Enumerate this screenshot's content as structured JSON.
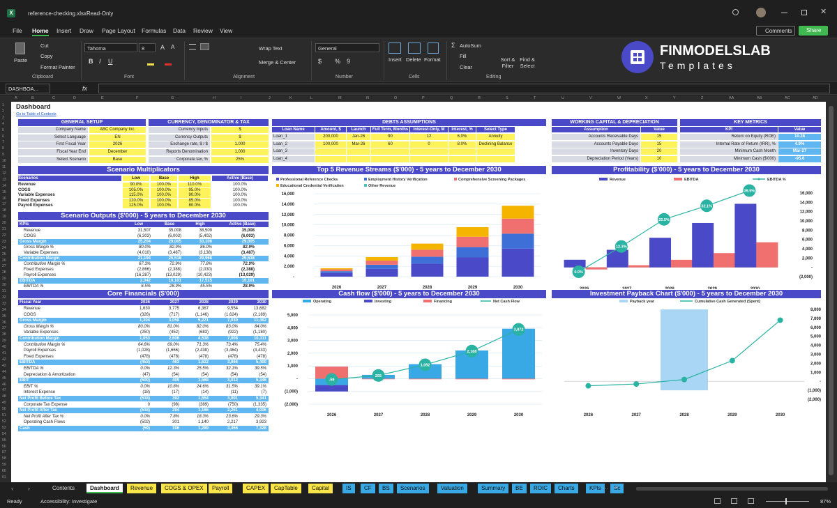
{
  "window": {
    "file": "reference-checking.xlsx",
    "mode": "Read-Only",
    "comments": "Comments",
    "share": "Share"
  },
  "menu": [
    "File",
    "Home",
    "Insert",
    "Draw",
    "Page Layout",
    "Formulas",
    "Data",
    "Review",
    "View"
  ],
  "ribbon": {
    "paste": "Paste",
    "cut": "Cut",
    "copy": "Copy",
    "format_painter": "Format Painter",
    "clipboard": "Clipboard",
    "font": "Tahoma",
    "size": "8",
    "font_label": "Font",
    "wrap": "Wrap Text",
    "merge": "Merge & Center",
    "alignment": "Alignment",
    "number_format": "General",
    "number": "Number",
    "insert": "Insert",
    "delete": "Delete",
    "format": "Format",
    "cells": "Cells",
    "autosum": "AutoSum",
    "fill": "Fill",
    "clear": "Clear",
    "sort": "Sort & Filter",
    "find": "Find & Select",
    "editing": "Editing",
    "brand1": "FINMODELSLAB",
    "brand2": "Templates"
  },
  "formula_bar": {
    "name_box": "DASHBOA...",
    "fx": "fx"
  },
  "columns": [
    "A",
    "B",
    "C",
    "D",
    "E",
    "F",
    "G",
    "H",
    "I",
    "J",
    "K",
    "L",
    "M",
    "N",
    "O",
    "P",
    "Q",
    "R",
    "S",
    "T",
    "U",
    "V",
    "W",
    "X",
    "Y",
    "Z",
    "AA",
    "AB",
    "AC",
    "AD"
  ],
  "sheet": {
    "title": "Dashboard",
    "link": "Go to Table of Contents",
    "general": {
      "header": "GENERAL SETUP",
      "rows": [
        [
          "Company Name",
          "ABC Company Inc."
        ],
        [
          "Select Language",
          "EN"
        ],
        [
          "First Fiscal Year",
          "2026"
        ],
        [
          "Fiscal Year End",
          "December"
        ],
        [
          "Select Scenario",
          "Base"
        ]
      ]
    },
    "currency": {
      "header": "CURRENCY, DENOMINATOR & TAX",
      "rows": [
        [
          "Currency Inputs",
          "$"
        ],
        [
          "Currency Outputs",
          "$"
        ],
        [
          "Exchange rate, $ / $",
          "1.000"
        ],
        [
          "Reports Denomination",
          "1,000"
        ],
        [
          "Corporate tax, %",
          "25%"
        ]
      ]
    },
    "debts": {
      "header": "DEBTS ASSUMPTIONS",
      "cols": [
        "Loan Name",
        "Amount, $",
        "Launch",
        "Full Term, Months",
        "Interest-Only, M",
        "Interest, %",
        "Select Type"
      ],
      "rows": [
        [
          "Loan_1",
          "200,000",
          "Jan-26",
          "90",
          "12",
          "6.0%",
          "Annuity"
        ],
        [
          "Loan_2",
          "100,000",
          "Mar-26",
          "60",
          "0",
          "8.0%",
          "Declining Balance"
        ],
        [
          "Loan_3",
          "",
          "",
          "",
          "",
          "",
          ""
        ],
        [
          "Loan_4",
          "",
          "",
          "",
          "",
          "",
          ""
        ]
      ]
    },
    "wc": {
      "header": "WORKING CAPITAL & DEPRECIATION",
      "cols": [
        "Assumption",
        "Value"
      ],
      "rows": [
        [
          "Accounts Receivable Days",
          "15"
        ],
        [
          "Accounts Payable Days",
          "15"
        ],
        [
          "Inventory Days",
          "20"
        ],
        [
          "Depreciation Period (Years)",
          "10"
        ]
      ]
    },
    "kpi": {
      "header": "KEY METRICS",
      "cols": [
        "KPI",
        "Value"
      ],
      "rows": [
        [
          "Return on Equity (ROE)",
          "10.28"
        ],
        [
          "Internal Rate of Return (IRR), %",
          "4.9%"
        ],
        [
          "Minimum Cash Month",
          "Mar-27"
        ],
        [
          "Minimum Cash ($'000)",
          "-95.6"
        ]
      ]
    },
    "multipliers": {
      "header": "Scenario Multiplicators",
      "cols": [
        "Scenarios",
        "Low",
        "Base",
        "High",
        "Active (Base)"
      ],
      "rows": [
        [
          "Revenue",
          "90.0%",
          "100.0%",
          "110.0%",
          "100.0%"
        ],
        [
          "COGS",
          "105.0%",
          "100.0%",
          "95.0%",
          "100.0%"
        ],
        [
          "Variable Expenses",
          "115.0%",
          "100.0%",
          "90.0%",
          "100.0%"
        ],
        [
          "Fixed Expenses",
          "120.0%",
          "100.0%",
          "85.0%",
          "100.0%"
        ],
        [
          "Payroll Expenses",
          "125.0%",
          "100.0%",
          "80.0%",
          "100.0%"
        ]
      ]
    },
    "outputs": {
      "header": "Scenario Outputs ($'000) - 5 years to December 2030",
      "cols": [
        "KPIs",
        "Low",
        "Base",
        "High",
        "Active (Base)"
      ],
      "rows": [
        [
          "Revenue",
          "31,507",
          "35,008",
          "38,509",
          "35,008",
          "n"
        ],
        [
          "COGS",
          "(6,303)",
          "(6,003)",
          "(5,402)",
          "(6,003)",
          "nb"
        ],
        [
          "Gross Margin",
          "25,204",
          "29,005",
          "33,106",
          "29,005",
          "h"
        ],
        [
          "Gross Margin %",
          "80.0%",
          "82.9%",
          "86.0%",
          "82.9%",
          "i"
        ],
        [
          "Variable Expenses",
          "(4,010)",
          "(3,487)",
          "(3,138)",
          "(3,487)",
          "nb"
        ],
        [
          "Contribution Margin",
          "21,194",
          "25,518",
          "29,968",
          "25,518",
          "h"
        ],
        [
          "Contribution Margin %",
          "67.3%",
          "72.9%",
          "77.8%",
          "72.9%",
          "i"
        ],
        [
          "Fixed Expenses",
          "(2,866)",
          "(2,388)",
          "(2,030)",
          "(2,388)",
          "nb"
        ],
        [
          "Payroll Expenses",
          "(16,287)",
          "(13,029)",
          "(10,423)",
          "(13,029)",
          "nb"
        ],
        [
          "EBITDA",
          "2,042",
          "10,101",
          "17,515",
          "10,101",
          "h"
        ],
        [
          "EBITDA %",
          "6.5%",
          "28.9%",
          "45.5%",
          "28.9%",
          "i"
        ]
      ]
    },
    "core": {
      "header": "Core Financials ($'000)",
      "cols": [
        "Fiscal Year",
        "2026",
        "2027",
        "2028",
        "2029",
        "2030"
      ],
      "rows": [
        [
          "Revenue",
          "1,630",
          "3,775",
          "6,367",
          "9,554",
          "13,682",
          "n"
        ],
        [
          "COGS",
          "(326)",
          "(717)",
          "(1,146)",
          "(1,624)",
          "(2,189)",
          "n"
        ],
        [
          "Gross Margin",
          "1,304",
          "3,058",
          "5,221",
          "7,930",
          "11,492",
          "h"
        ],
        [
          "Gross Margin %",
          "80.0%",
          "81.0%",
          "82.0%",
          "83.0%",
          "84.0%",
          "i"
        ],
        [
          "Variable Expenses",
          "(250)",
          "(452)",
          "(683)",
          "(922)",
          "(1,180)",
          "n"
        ],
        [
          "Contribution Margin",
          "1,053",
          "2,606",
          "4,538",
          "7,008",
          "10,311",
          "h"
        ],
        [
          "Contribution Margin %",
          "64.6%",
          "69.0%",
          "71.3%",
          "73.4%",
          "75.4%",
          "i"
        ],
        [
          "Payroll Expenses",
          "(1,028)",
          "(1,666)",
          "(2,438)",
          "(3,464)",
          "(4,433)",
          "n"
        ],
        [
          "Fixed Expenses",
          "(478)",
          "(478)",
          "(478)",
          "(478)",
          "(478)",
          "n"
        ],
        [
          "EBITDA",
          "(453)",
          "463",
          "1,622",
          "3,066",
          "5,400",
          "h"
        ],
        [
          "EBITDA %",
          "0.0%",
          "12.3%",
          "25.5%",
          "32.1%",
          "39.5%",
          "i"
        ],
        [
          "Depreciation & Amortization",
          "(47)",
          "(54)",
          "(54)",
          "(54)",
          "(54)",
          "n"
        ],
        [
          "EBIT",
          "(500)",
          "409",
          "1,568",
          "3,012",
          "5,346",
          "h"
        ],
        [
          "EBIT %",
          "0.0%",
          "10.8%",
          "24.6%",
          "31.5%",
          "39.1%",
          "i"
        ],
        [
          "Interest Expense",
          "(18)",
          "(17)",
          "(14)",
          "(11)",
          "(7)",
          "n"
        ],
        [
          "Net Profit Before Tax",
          "(518)",
          "392",
          "1,554",
          "3,001",
          "5,341",
          "h"
        ],
        [
          "Corporate Tax Expense",
          "0",
          "(98)",
          "(389)",
          "(750)",
          "(1,335)",
          "n"
        ],
        [
          "Net Profit After Tax",
          "(518)",
          "294",
          "1,166",
          "2,251",
          "4,006",
          "h"
        ],
        [
          "Net Profit After Tax %",
          "0.0%",
          "7.8%",
          "18.3%",
          "23.6%",
          "29.3%",
          "i"
        ],
        [
          "Operating Cash Flows",
          "(502)",
          "301",
          "1,140",
          "2,217",
          "3,923",
          "n"
        ],
        [
          "Cash",
          "(59)",
          "196",
          "1,289",
          "3,456",
          "7,328",
          "h"
        ]
      ]
    },
    "rows_count": 61
  },
  "chart_revenue": {
    "title": "Top 5 Revenue Streams ($'000) - 5 years to December 2030",
    "legend": [
      "Professional Reference Checks",
      "Employment History Verification",
      "Comprehensive Screening Packages",
      "Educational Credential Verification",
      "Other Revenue"
    ],
    "colors": [
      "#4a49c8",
      "#3d6fd6",
      "#f07070",
      "#f4b400",
      "#4dc1c1"
    ],
    "years": [
      "2026",
      "2027",
      "2028",
      "2029",
      "2030"
    ],
    "stacks": [
      [
        700,
        1500,
        2500,
        3700,
        5400
      ],
      [
        350,
        800,
        1350,
        2000,
        2900
      ],
      [
        350,
        800,
        1350,
        2000,
        2900
      ],
      [
        230,
        670,
        1170,
        1850,
        2480
      ],
      [
        0,
        0,
        0,
        0,
        0
      ]
    ],
    "yticks": [
      "16,000",
      "14,000",
      "12,000",
      "10,000",
      "8,000",
      "6,000",
      "4,000",
      "2,000",
      "-"
    ],
    "ymax": 16000
  },
  "chart_profit": {
    "title": "Profitability ($'000) - 5 years to December 2030",
    "legend": [
      "Revenue",
      "EBITDA",
      "EBITDA %"
    ],
    "colors": [
      "#4a49c8",
      "#f07070",
      "#2ab3a3"
    ],
    "years": [
      "2026",
      "2027",
      "2028",
      "2029",
      "2030"
    ],
    "revenue": [
      1630,
      3775,
      6367,
      9554,
      13682
    ],
    "ebitda": [
      -453,
      463,
      1622,
      3066,
      5400
    ],
    "pct": [
      "0.0%",
      "12.3%",
      "25.5%",
      "32.1%",
      "39.5%"
    ],
    "pctv": [
      0,
      12.3,
      25.5,
      32.1,
      39.5
    ],
    "yticks": [
      "16,000",
      "14,000",
      "12,000",
      "10,000",
      "8,000",
      "6,000",
      "4,000",
      "2,000",
      "-",
      "(2,000)"
    ]
  },
  "chart_cash": {
    "title": "Cash flow ($'000) - 5 years to December 2030",
    "legend": [
      "Operating",
      "Investing",
      "Financing",
      "Net Cash Flow"
    ],
    "colors": [
      "#38a9e4",
      "#4a49c8",
      "#f07070",
      "#2ab3a3"
    ],
    "years": [
      "2026",
      "2027",
      "2028",
      "2029",
      "2030"
    ],
    "operating": [
      -502,
      301,
      1140,
      2217,
      3923
    ],
    "investing": [
      -500,
      0,
      0,
      0,
      0
    ],
    "financing": [
      950,
      -46,
      -48,
      -50,
      -51
    ],
    "net": [
      -59,
      255,
      1092,
      2168,
      3872
    ],
    "net_labels": [
      "-59",
      "255",
      "1,092",
      "2,168",
      "3,872"
    ],
    "yticks": [
      "5,000",
      "4,000",
      "3,000",
      "2,000",
      "1,000",
      "-",
      "(1,000)",
      "(2,000)"
    ]
  },
  "chart_payback": {
    "title": "Investment Payback Chart ($'000) - 5 years to December 2030",
    "legend": [
      "Payback year",
      "Cumulative Cash Generated (Spent)"
    ],
    "colors": [
      "#a9d6f5",
      "#2ab3a3"
    ],
    "years": [
      "2026",
      "2027",
      "2028",
      "2029",
      "2030"
    ],
    "cum": [
      -500,
      -300,
      200,
      2300,
      6800
    ],
    "payback_year": "2028",
    "yticks": [
      "8,000",
      "7,000",
      "6,000",
      "5,000",
      "4,000",
      "3,000",
      "2,000",
      "1,000",
      "-",
      "(1,000)",
      "(2,000)"
    ]
  },
  "tabs": [
    {
      "label": "Contents",
      "c": "#1f1f1f",
      "t": "#ddd"
    },
    {
      "label": "Dashboard",
      "c": "#ffffff",
      "t": "#111"
    },
    {
      "label": "Revenue",
      "c": "#f9e547",
      "t": "#111"
    },
    {
      "label": "COGS & OPEX",
      "c": "#f9e547",
      "t": "#111"
    },
    {
      "label": "Payroll",
      "c": "#f9e547",
      "t": "#111"
    },
    {
      "label": "CAPEX",
      "c": "#f9e547",
      "t": "#111"
    },
    {
      "label": "CapTable",
      "c": "#f9e547",
      "t": "#111"
    },
    {
      "label": "Capital",
      "c": "#f9e547",
      "t": "#111"
    },
    {
      "label": "IS",
      "c": "#38a9e4",
      "t": "#111"
    },
    {
      "label": "CF",
      "c": "#38a9e4",
      "t": "#111"
    },
    {
      "label": "BS",
      "c": "#38a9e4",
      "t": "#111"
    },
    {
      "label": "Scenarios",
      "c": "#38a9e4",
      "t": "#111"
    },
    {
      "label": "Valuation",
      "c": "#38a9e4",
      "t": "#111"
    },
    {
      "label": "Summary",
      "c": "#38a9e4",
      "t": "#111"
    },
    {
      "label": "BE",
      "c": "#38a9e4",
      "t": "#111"
    },
    {
      "label": "ROIC",
      "c": "#38a9e4",
      "t": "#111"
    },
    {
      "label": "Charts",
      "c": "#38a9e4",
      "t": "#111"
    },
    {
      "label": "KPIs",
      "c": "#38a9e4",
      "t": "#111"
    },
    {
      "label": "Sc",
      "c": "#38a9e4",
      "t": "#111"
    }
  ],
  "status": {
    "ready": "Ready",
    "accessibility": "Accessibility: Investigate",
    "zoom": "87%"
  }
}
